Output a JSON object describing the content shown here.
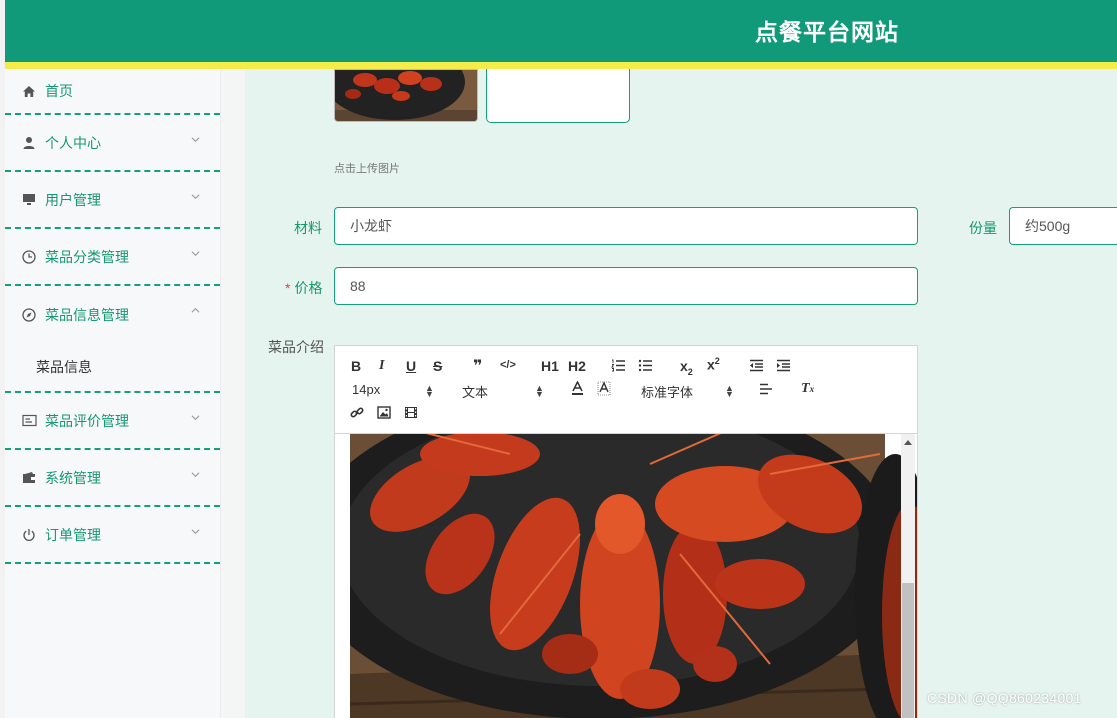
{
  "header": {
    "title": "点餐平台网站"
  },
  "sidebar": {
    "items": [
      {
        "label": "首页",
        "icon": "home-icon",
        "expandable": false
      },
      {
        "label": "个人中心",
        "icon": "user-icon",
        "expandable": true
      },
      {
        "label": "用户管理",
        "icon": "monitor-icon",
        "expandable": true
      },
      {
        "label": "菜品分类管理",
        "icon": "clock-icon",
        "expandable": true
      },
      {
        "label": "菜品信息管理",
        "icon": "compass-icon",
        "expandable": true,
        "expanded": true,
        "children": [
          {
            "label": "菜品信息"
          }
        ]
      },
      {
        "label": "菜品评价管理",
        "icon": "card-icon",
        "expandable": true
      },
      {
        "label": "系统管理",
        "icon": "wallet-icon",
        "expandable": true
      },
      {
        "label": "订单管理",
        "icon": "power-icon",
        "expandable": true
      }
    ]
  },
  "upload": {
    "hint": "点击上传图片"
  },
  "form": {
    "material": {
      "label": "材料",
      "value": "小龙虾"
    },
    "portion": {
      "label": "份量",
      "value": "约500g"
    },
    "price": {
      "label": "价格",
      "required_mark": "*",
      "value": "88"
    },
    "description": {
      "label": "菜品介绍"
    }
  },
  "editor": {
    "toolbar": {
      "bold": "B",
      "italic": "I",
      "underline": "U",
      "strike": "S",
      "quote": "❞",
      "code": "</>",
      "h1": "H1",
      "h2": "H2",
      "font_size": "14px",
      "text_type": "文本",
      "font_family": "标准字体"
    }
  },
  "colors": {
    "brand": "#109a7a",
    "accent_stripe": "#f4ec4a",
    "label_green": "#16976f",
    "required": "#e04040"
  },
  "watermark": "CSDN @QQ860234001"
}
